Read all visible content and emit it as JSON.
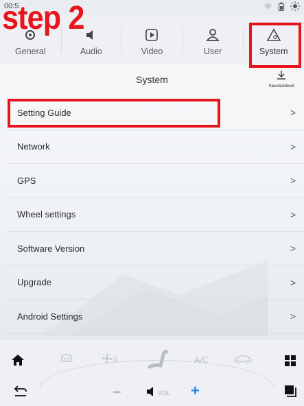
{
  "status": {
    "time": "00:5"
  },
  "overlay": {
    "step_text": "step 2"
  },
  "tabs": [
    {
      "label": "General",
      "icon": "gear-icon"
    },
    {
      "label": "Audio",
      "icon": "speaker-icon"
    },
    {
      "label": "Video",
      "icon": "play-icon"
    },
    {
      "label": "User",
      "icon": "user-icon"
    },
    {
      "label": "System",
      "icon": "system-triangle-icon",
      "active": true
    }
  ],
  "header": {
    "title": "System",
    "save_label": "Save&reboot"
  },
  "menu": [
    {
      "label": "Setting Guide",
      "chevron": ">"
    },
    {
      "label": "Network",
      "chevron": ">"
    },
    {
      "label": "GPS",
      "chevron": ">"
    },
    {
      "label": "Wheel settings",
      "chevron": ">"
    },
    {
      "label": "Software Version",
      "chevron": ">"
    },
    {
      "label": "Upgrade",
      "chevron": ">"
    },
    {
      "label": "Android Settings",
      "chevron": ">"
    }
  ],
  "bottom": {
    "fan_level": "0",
    "ac_label": "A/C",
    "vol_label": "VOL",
    "minus": "−",
    "plus": "+"
  },
  "colors": {
    "highlight": "#e8141c",
    "accent": "#1e88e5"
  }
}
